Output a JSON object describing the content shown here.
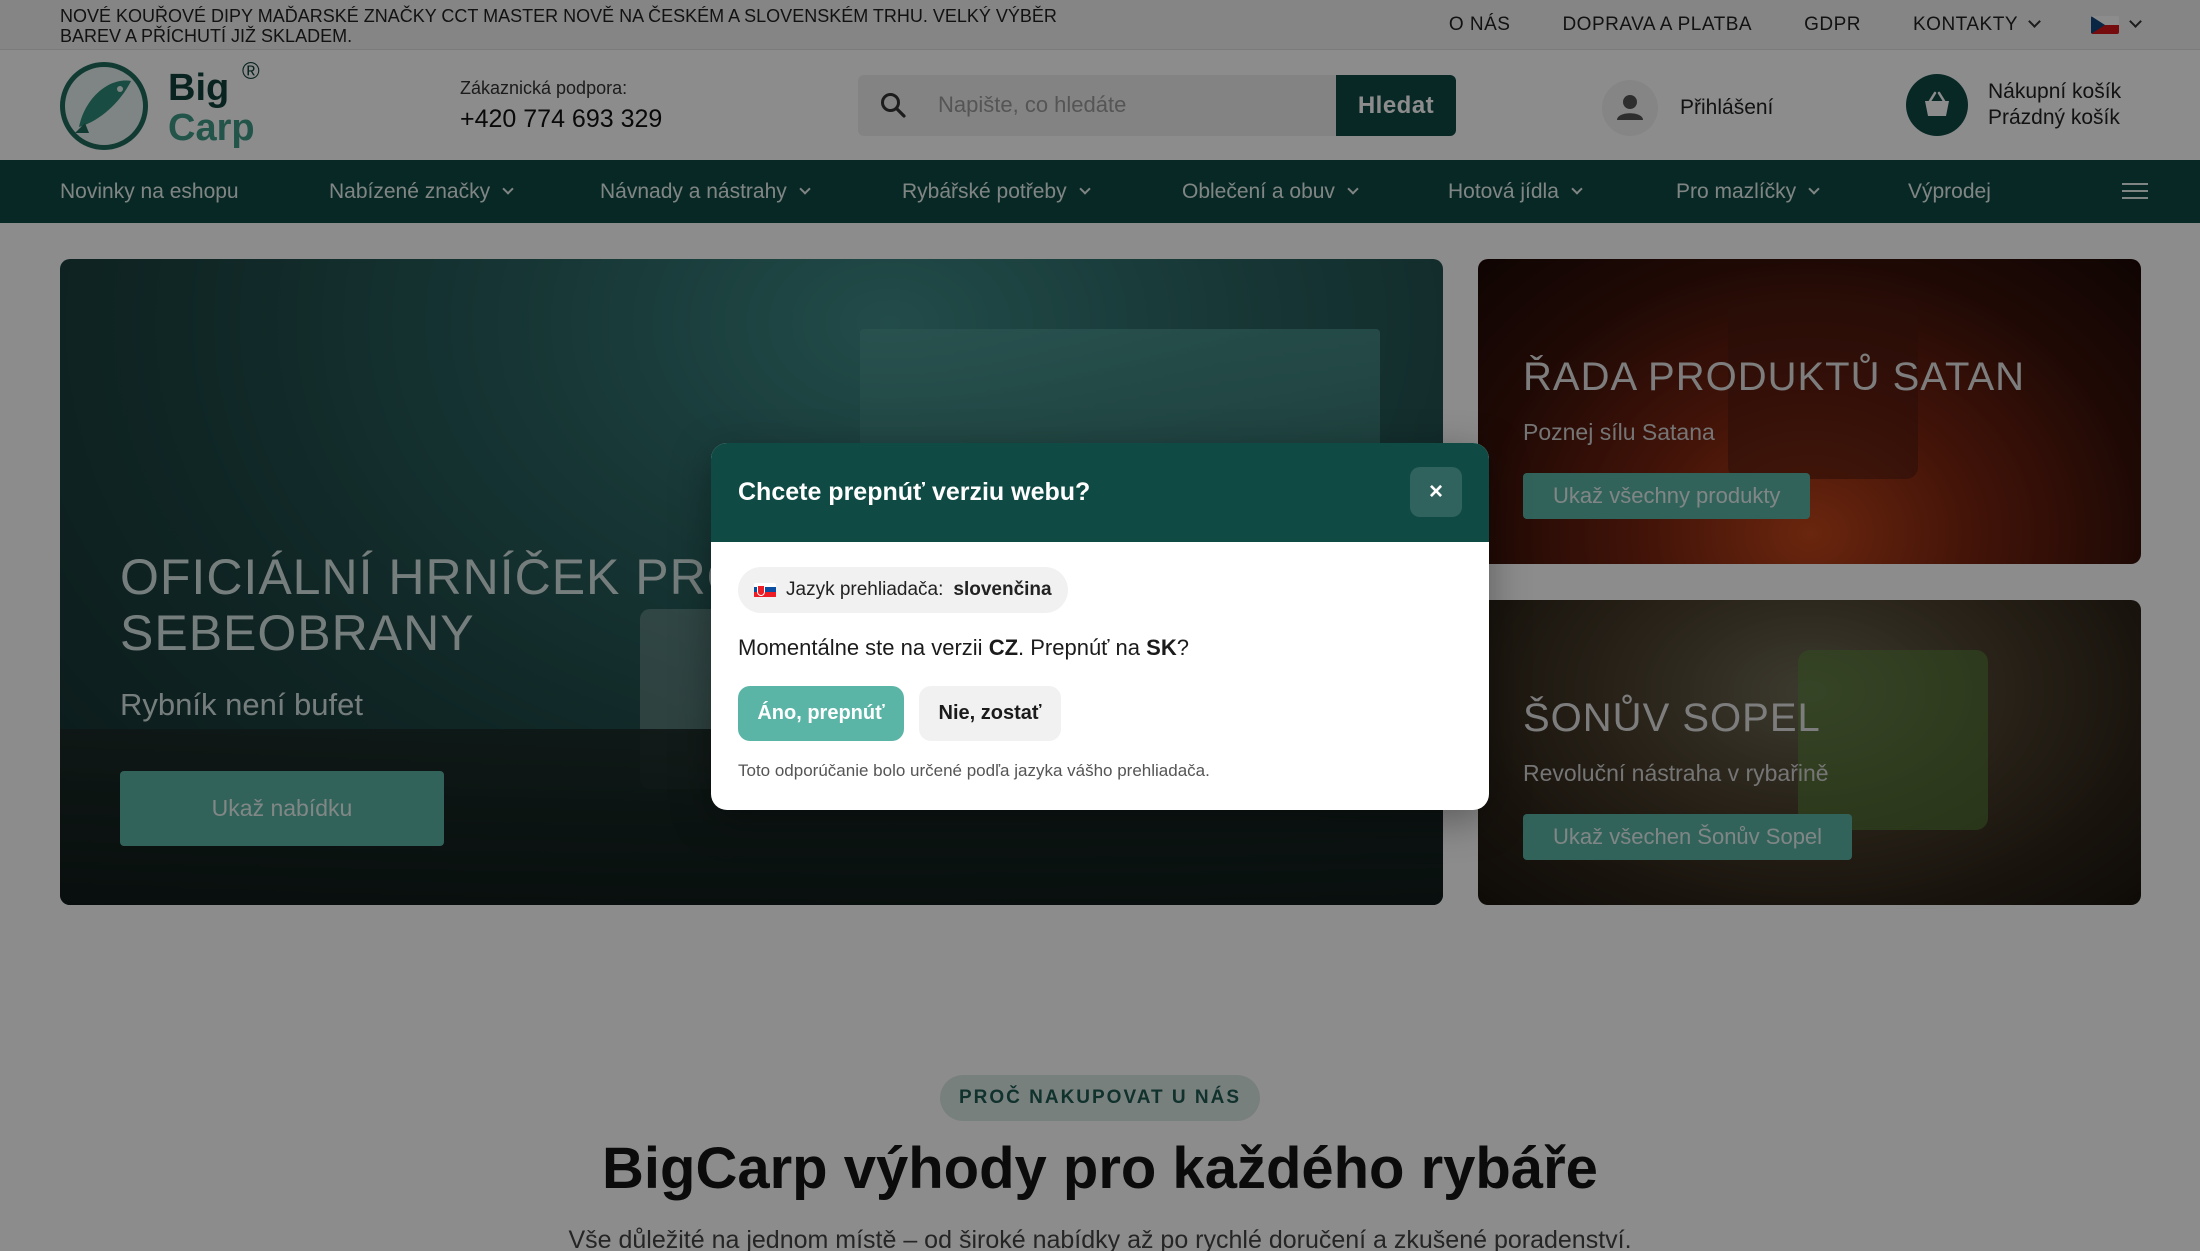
{
  "topbar": {
    "announcement": "Nové kouřové dipy maďarské značky CCT Master nově na českém a slovenském trhu. Velký výběr barev a příchutí již skladem.",
    "links": [
      "O NÁS",
      "DOPRAVA A PLATBA",
      "GDPR",
      "KONTAKTY"
    ],
    "language_flag": "flag-cz-icon"
  },
  "header": {
    "logo_line1": "Big",
    "logo_line2": "Carp",
    "logo_reg": "®",
    "support_label": "Zákaznická podpora:",
    "support_phone": "+420 774 693 329",
    "search_placeholder": "Napište, co hledáte",
    "search_button": "Hledat",
    "login_label": "Přihlášení",
    "cart_title": "Nákupní košík",
    "cart_status": "Prázdný košík"
  },
  "nav": {
    "items": [
      {
        "label": "Novinky na eshopu"
      },
      {
        "label": "Nabízené značky"
      },
      {
        "label": "Návnady a nástrahy"
      },
      {
        "label": "Rybářské potřeby"
      },
      {
        "label": "Oblečení a obuv"
      },
      {
        "label": "Hotová jídla"
      },
      {
        "label": "Pro mazlíčky"
      },
      {
        "label": "Výprodej"
      }
    ]
  },
  "hero": {
    "main_title_line1": "OFICIÁLNÍ HRNÍČEK PRO",
    "main_title_line2": "SEBEOBRANY",
    "main_subtitle": "Rybník není bufet",
    "main_button": "Ukaž nabídku",
    "side1_title": "ŘADA PRODUKTŮ SATAN",
    "side1_subtitle": "Poznej sílu Satana",
    "side1_button": "Ukaž všechny produkty",
    "side2_title": "ŠONŮV SOPEL",
    "side2_subtitle": "Revoluční nástraha v rybařině",
    "side2_button": "Ukaž všechen Šonův Sopel"
  },
  "why": {
    "badge": "PROČ NAKUPOVAT U NÁS",
    "title": "BigCarp výhody pro každého rybáře",
    "subtitle": "Vše důležité na jednom místě – od široké nabídky až po rychlé doručení a zkušené poradenství."
  },
  "modal": {
    "title": "Chcete prepnúť verziu webu?",
    "close": "×",
    "browser_lang_label": "Jazyk prehliadača:",
    "browser_lang_value": "slovenčina",
    "message_prefix": "Momentálne ste na verzii",
    "current_version": "CZ",
    "message_mid": ". Prepnúť na",
    "target_version": "SK",
    "message_suffix": "?",
    "yes_button": "Áno, prepnúť",
    "no_button": "Nie, zostať",
    "note": "Toto odporúčanie bolo určené podľa jazyka vášho prehliadača."
  },
  "colors": {
    "brand_dark": "#0f4a44",
    "brand_accent": "#5bb5a6"
  }
}
